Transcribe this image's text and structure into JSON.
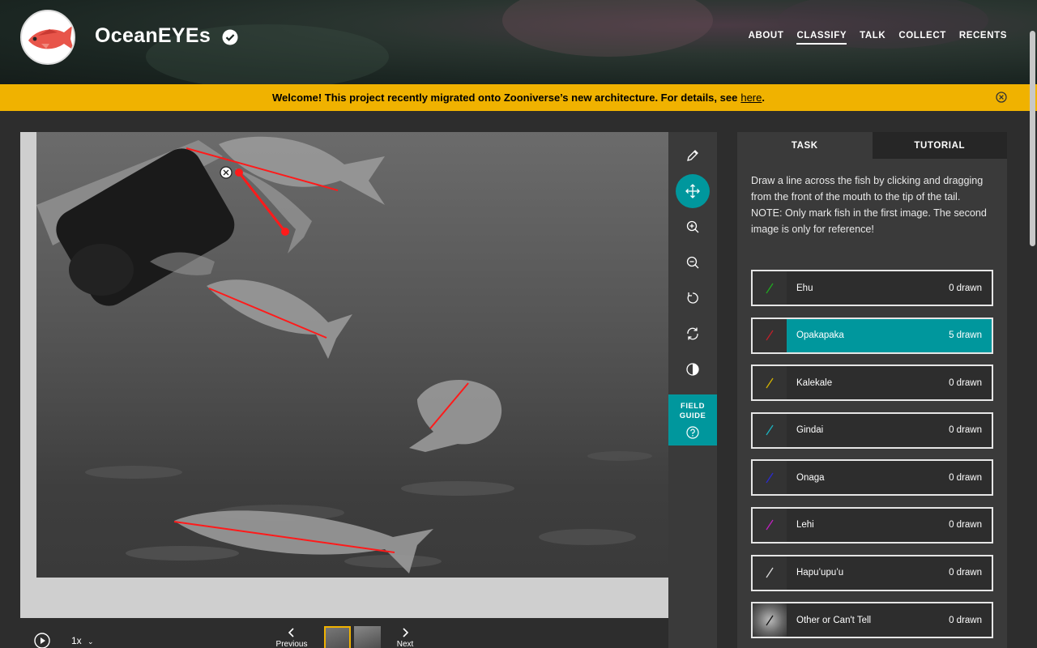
{
  "header": {
    "project_name": "OceanEYEs",
    "nav": [
      "ABOUT",
      "CLASSIFY",
      "TALK",
      "COLLECT",
      "RECENTS"
    ],
    "active_nav": "CLASSIFY"
  },
  "banner": {
    "message": "Welcome! This project recently migrated onto Zooniverse’s new architecture. For details, see",
    "link_text": "here",
    "suffix": "."
  },
  "toolbar": {
    "field_guide_line1": "FIELD",
    "field_guide_line2": "GUIDE"
  },
  "controls": {
    "speed": "1x",
    "previous": "Previous",
    "next": "Next"
  },
  "task": {
    "tabs": [
      "TASK",
      "TUTORIAL"
    ],
    "instructions_1": "Draw a line across the fish by clicking and dragging from the front of the mouth to the tip of the tail.",
    "instructions_2": "NOTE: Only mark fish in the first image. The second image is only for reference!",
    "choices": [
      {
        "label": "Ehu",
        "count": "0 drawn",
        "color": "#1fa81f"
      },
      {
        "label": "Opakapaka",
        "count": "5 drawn",
        "color": "#c0202a"
      },
      {
        "label": "Kalekale",
        "count": "0 drawn",
        "color": "#d4b400"
      },
      {
        "label": "Gindai",
        "count": "0 drawn",
        "color": "#1bb3c0"
      },
      {
        "label": "Onaga",
        "count": "0 drawn",
        "color": "#2a2ad0"
      },
      {
        "label": "Lehi",
        "count": "0 drawn",
        "color": "#c020c0"
      },
      {
        "label": "Hapu’upu’u",
        "count": "0 drawn",
        "color": "#dddddd"
      },
      {
        "label": "Other or Can't Tell",
        "count": "0 drawn",
        "color": "#dddddd"
      }
    ],
    "selected_index": 1
  },
  "colors": {
    "accent": "#00979d",
    "banner": "#f0b200",
    "annotation": "#ff1a1a"
  }
}
